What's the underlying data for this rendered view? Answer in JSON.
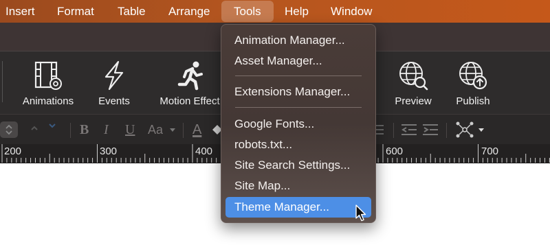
{
  "menubar": {
    "items": [
      "Insert",
      "Format",
      "Table",
      "Arrange",
      "Tools",
      "Help",
      "Window"
    ],
    "active": "Tools"
  },
  "toolbar": {
    "buttons": [
      {
        "label": "Animations",
        "icon": "film-gear-icon"
      },
      {
        "label": "Events",
        "icon": "lightning-icon"
      },
      {
        "label": "Motion Effect",
        "icon": "running-figure-icon"
      },
      {
        "label": "Preview",
        "icon": "globe-search-icon"
      },
      {
        "label": "Publish",
        "icon": "globe-upload-icon"
      }
    ]
  },
  "formatbar": {
    "bold": "B",
    "italic": "I",
    "underline": "U",
    "font_size": "Aa",
    "text_color": "A"
  },
  "ruler": {
    "labels": [
      "200",
      "300",
      "400",
      "600",
      "700"
    ]
  },
  "tools_menu": {
    "items": [
      "Animation Manager...",
      "Asset Manager...",
      "Extensions Manager...",
      "Google Fonts...",
      "robots.txt...",
      "Site Search Settings...",
      "Site Map...",
      "Theme Manager..."
    ],
    "highlighted": "Theme Manager..."
  },
  "colors": {
    "menubar_accent": "#b5561f",
    "highlight": "#4d8fe6"
  }
}
